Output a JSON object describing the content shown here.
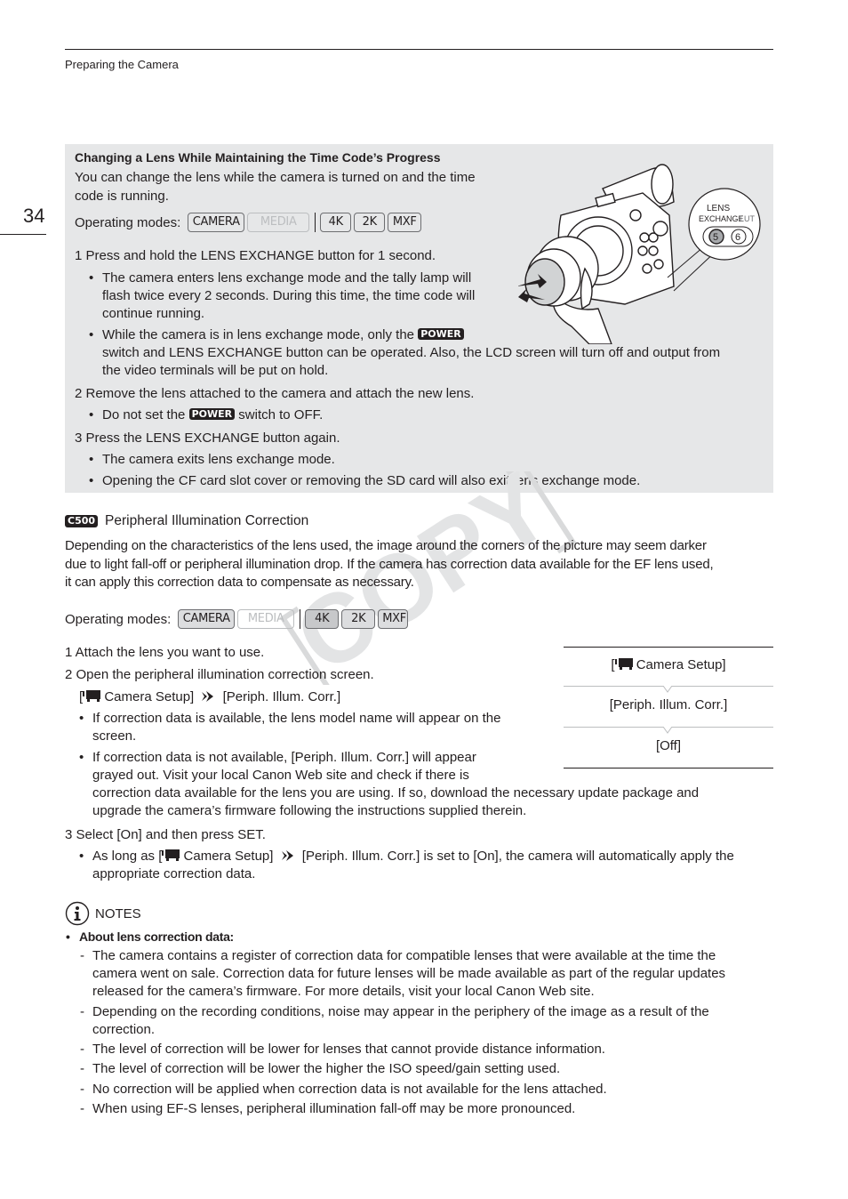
{
  "header": {
    "running_head": "Preparing the Camera",
    "page_number": "34"
  },
  "tip_box": {
    "title": "Changing a Lens While Maintaining the Time Code’s Progress",
    "intro_line1": "You can change the lens while the camera is turned on and the time",
    "intro_line2": "code is running.",
    "operating_modes_label": "Operating modes:",
    "modes": [
      {
        "label": "CAMERA",
        "active": true
      },
      {
        "label": "MEDIA",
        "active": false
      },
      {
        "label": "4K",
        "active": true
      },
      {
        "label": "2K",
        "active": true
      },
      {
        "label": "MXF",
        "active": true
      }
    ],
    "illustration": {
      "callout_line1": "LENS",
      "callout_line2": "EXCHANGE",
      "callout_lut": "LUT",
      "button_5": "5",
      "button_6": "6"
    },
    "power_badge": "POWER",
    "steps": {
      "s1": "1  Press and hold the LENS EXCHANGE button for 1 second.",
      "s1_b1_l1": "The camera enters lens exchange mode and the tally lamp will",
      "s1_b1_l2": "flash twice every 2 seconds. During this time, the time code will",
      "s1_b1_l3": "continue running.",
      "s1_b2_l1_pre": "While the camera is in lens exchange mode, only the",
      "s1_b2_l2": "switch and LENS EXCHANGE button can be operated. Also, the LCD screen will turn off and output from",
      "s1_b2_l3": "the video terminals will be put on hold.",
      "s2": "2  Remove the lens attached to the camera and attach the new lens.",
      "s2_b1_pre": "Do not set the",
      "s2_b1_post": "switch to OFF.",
      "s3": "3  Press the LENS EXCHANGE button again.",
      "s3_b1": "The camera exits lens exchange mode.",
      "s3_b2": "Opening the CF card slot cover or removing the SD card will also exit lens exchange mode."
    }
  },
  "section": {
    "model_badge": "C500",
    "title": "Peripheral Illumination Correction",
    "intro_l1": "Depending on the characteristics of the lens used, the image around the corners of the picture may seem darker",
    "intro_l2": "due to light fall-off or peripheral illumination drop. If the camera has correction data available for the EF lens used,",
    "intro_l3": "it can apply this correction data to compensate as necessary.",
    "operating_modes_label": "Operating modes:",
    "modes": [
      {
        "label": "CAMERA",
        "active": true
      },
      {
        "label": "MEDIA",
        "active": false
      },
      {
        "label": "4K",
        "active": true
      },
      {
        "label": "2K",
        "active": true
      },
      {
        "label": "MXF",
        "active": true
      }
    ],
    "steps": {
      "s1": "1  Attach the lens you want to use.",
      "s2": "2  Open the peripheral illumination correction screen.",
      "s2_path_a": "[",
      "s2_path_b": " Camera Setup]",
      "s2_path_c": "[Periph. Illum. Corr.]",
      "s2_b1_l1": "If correction data is available, the lens model name will appear on the",
      "s2_b1_l2": "screen.",
      "s2_b2_l1": "If correction data is not available, [Periph. Illum. Corr.] will appear",
      "s2_b2_l2": "grayed out. Visit your local Canon Web site and check if there is",
      "s2_b2_l3": "correction data available for the lens you are using. If so, download the necessary update package and",
      "s2_b2_l4": "upgrade the camera’s firmware following the instructions supplied therein.",
      "s3": "3   Select [On] and then press SET.",
      "s3_b1_a": "As long as [",
      "s3_b1_b": " Camera Setup]",
      "s3_b1_c": "[Periph. Illum. Corr.] is set to [On], the camera will automatically apply the",
      "s3_b1_l2": "appropriate correction data."
    },
    "menu_diagram": {
      "item1_a": "[",
      "item1_b": " Camera Setup]",
      "item2": "[Periph. Illum. Corr.]",
      "item3": "[Off]"
    }
  },
  "notes": {
    "heading": "NOTES",
    "bullet_title": "About lens correction data:",
    "items": [
      "The camera contains a register of correction data for compatible lenses that were available at the time the",
      "camera went on sale. Correction data for future lenses will be made available as part of the regular updates",
      "released for the camera’s firmware. For more details, visit your local Canon Web site.",
      "Depending on the recording conditions, noise may appear in the periphery of the image as a result of the",
      "correction.",
      "The level of correction will be lower for lenses that cannot provide distance information.",
      "The level of correction will be lower the higher the ISO speed/gain setting used.",
      "No correction will be applied when correction data is not available for the lens attached.",
      "When using EF-S lenses, peripheral illumination fall-off may be more pronounced."
    ]
  },
  "watermark": "COPY"
}
